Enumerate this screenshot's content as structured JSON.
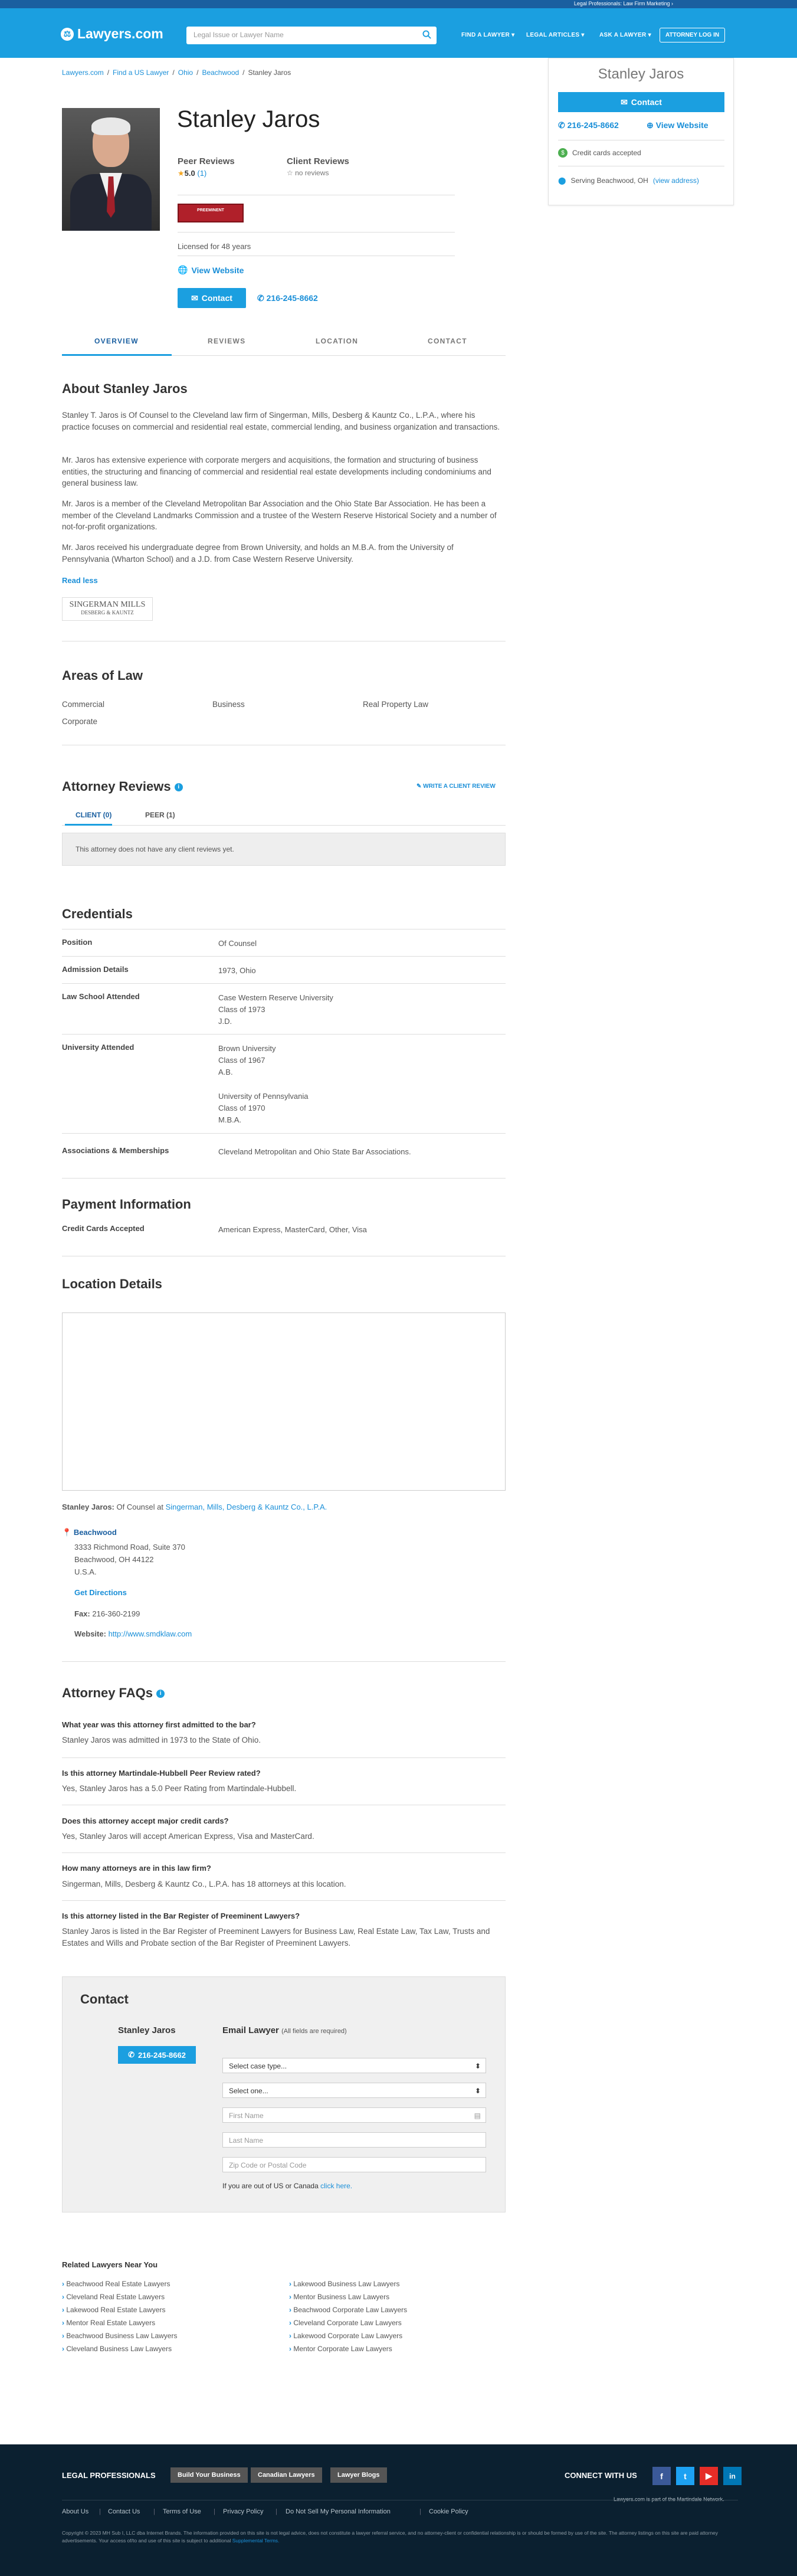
{
  "top_banner": {
    "text": "Legal Professionals: Law Firm Marketing ›"
  },
  "header": {
    "logo": "Lawyers.com",
    "search_placeholder": "Legal Issue or Lawyer Name",
    "nav": [
      "FIND A LAWYER ▾",
      "LEGAL ARTICLES ▾",
      "ASK A LAWYER ▾"
    ],
    "login": "ATTORNEY LOG IN"
  },
  "breadcrumb": [
    "Lawyers.com",
    "Find a US Lawyer",
    "Ohio",
    "Beachwood",
    "Stanley Jaros"
  ],
  "profile": {
    "name": "Stanley Jaros",
    "peer_reviews_label": "Peer Reviews",
    "peer_rating": "5.0",
    "peer_count": "(1)",
    "client_reviews_label": "Client Reviews",
    "client_reviews_value": "no reviews",
    "preeminent_badge": "PREEMINENT",
    "licensed": "Licensed for 48 years",
    "website": "View Website",
    "contact": "Contact",
    "phone": "216-245-8662"
  },
  "sidebar_card": {
    "name": "Stanley Jaros",
    "contact_button": "Contact",
    "phone": "216-245-8662",
    "website": "View Website",
    "credit_cards": "Credit cards accepted",
    "serving": "Serving Beachwood, OH",
    "view_address": "(view address)"
  },
  "tabs": [
    "OVERVIEW",
    "REVIEWS",
    "LOCATION",
    "CONTACT"
  ],
  "about": {
    "heading": "About Stanley Jaros",
    "paragraphs": [
      "Stanley T. Jaros is Of Counsel to the Cleveland law firm of Singerman, Mills, Desberg & Kauntz Co., L.P.A., where his practice focuses on commercial and residential real estate, commercial lending, and business organization and transactions.",
      "Mr. Jaros has extensive experience with corporate mergers and acquisitions, the formation and structuring of business entities, the structuring and financing of commercial and residential real estate developments including condominiums and general business law.",
      "Mr. Jaros is a member of the Cleveland Metropolitan Bar Association and the Ohio State Bar Association. He has been a member of the Cleveland Landmarks Commission and a trustee of the Western Reserve Historical Society and a number of not-for-profit organizations.",
      "Mr. Jaros received his undergraduate degree from Brown University, and holds an M.B.A. from the University of Pennsylvania (Wharton School) and a J.D. from Case Western Reserve University."
    ],
    "read_less": "Read less",
    "firm_logo": "SINGERMAN MILLS",
    "firm_logo_sub": "DESBERG & KAUNTZ"
  },
  "areas": {
    "heading": "Areas of Law",
    "items": [
      "Commercial",
      "Business",
      "Real Property Law",
      "Corporate"
    ]
  },
  "reviews": {
    "heading": "Attorney Reviews",
    "write": "WRITE A CLIENT REVIEW",
    "tabs": [
      "CLIENT (0)",
      "PEER (1)"
    ],
    "empty": "This attorney does not have any client reviews yet."
  },
  "credentials": {
    "heading": "Credentials",
    "rows": [
      {
        "label": "Position",
        "value": "Of Counsel"
      },
      {
        "label": "Admission Details",
        "value": "1973, Ohio"
      },
      {
        "label": "Law School Attended",
        "value": "Case Western Reserve University\nClass of 1973\nJ.D."
      },
      {
        "label": "University Attended",
        "value": "Brown University\nClass of 1967\nA.B.\n\nUniversity of Pennsylvania\nClass of 1970\nM.B.A."
      },
      {
        "label": "Associations & Memberships",
        "value": "Cleveland Metropolitan and Ohio State Bar Associations."
      }
    ]
  },
  "payment": {
    "heading": "Payment Information",
    "label": "Credit Cards Accepted",
    "value": "American Express, MasterCard, Other, Visa"
  },
  "location": {
    "heading": "Location Details",
    "attorney_line_name": "Stanley Jaros:",
    "attorney_line_role": "Of Counsel at",
    "firm_link": "Singerman, Mills, Desberg & Kauntz Co., L.P.A.",
    "city_heading": "Beachwood",
    "address": [
      "3333 Richmond Road, Suite 370",
      "Beachwood, OH 44122",
      "U.S.A."
    ],
    "directions": "Get Directions",
    "fax_label": "Fax:",
    "fax": "216-360-2199",
    "website_label": "Website:",
    "website": "http://www.smdklaw.com"
  },
  "faqs": {
    "heading": "Attorney FAQs",
    "items": [
      {
        "q": "What year was this attorney first admitted to the bar?",
        "a": "Stanley Jaros was admitted in 1973 to the State of Ohio."
      },
      {
        "q": "Is this attorney Martindale-Hubbell Peer Review rated?",
        "a": "Yes, Stanley Jaros has a 5.0 Peer Rating from Martindale-Hubbell."
      },
      {
        "q": "Does this attorney accept major credit cards?",
        "a": "Yes, Stanley Jaros will accept American Express, Visa and MasterCard."
      },
      {
        "q": "How many attorneys are in this law firm?",
        "a": "Singerman, Mills, Desberg & Kauntz Co., L.P.A. has 18 attorneys at this location."
      },
      {
        "q": "Is this attorney listed in the Bar Register of Preeminent Lawyers?",
        "a": "Stanley Jaros is listed in the Bar Register of Preeminent Lawyers for Business Law, Real Estate Law, Tax Law, Trusts and Estates and Wills and Probate section of the Bar Register of Preeminent Lawyers."
      }
    ]
  },
  "contact_form": {
    "heading": "Contact",
    "name": "Stanley Jaros",
    "phone": "216-245-8662",
    "email_heading": "Email Lawyer",
    "required_note": "(All fields are required)",
    "case_type": "Select case type...",
    "select_one": "Select one...",
    "first_name": "First Name",
    "last_name": "Last Name",
    "zip": "Zip Code or Postal Code",
    "outside_note": "If you are out of US or Canada",
    "click_here": "click here."
  },
  "related": {
    "heading": "Related Lawyers Near You",
    "col1": [
      "Beachwood Real Estate Lawyers",
      "Cleveland Real Estate Lawyers",
      "Lakewood Real Estate Lawyers",
      "Mentor Real Estate Lawyers",
      "Beachwood Business Law Lawyers",
      "Cleveland Business Law Lawyers"
    ],
    "col2": [
      "Lakewood Business Law Lawyers",
      "Mentor Business Law Lawyers",
      "Beachwood Corporate Law Lawyers",
      "Cleveland Corporate Law Lawyers",
      "Lakewood Corporate Law Lawyers",
      "Mentor Corporate Law Lawyers"
    ]
  },
  "footer": {
    "legal_pros": "LEGAL PROFESSIONALS",
    "buttons": [
      "Build Your Business",
      "Canadian Lawyers",
      "Lawyer Blogs"
    ],
    "connect": "CONNECT WITH US",
    "social": [
      "f",
      "t",
      "▶",
      "in"
    ],
    "part_of": "Lawyers.com is part of the Martindale Network.",
    "links": [
      "About Us",
      "Contact Us",
      "Terms of Use",
      "Privacy Policy",
      "Do Not Sell My Personal Information",
      "Cookie Policy"
    ],
    "copyright": "Copyright © 2023 MH Sub I, LLC dba Internet Brands. The information provided on this site is not legal advice, does not constitute a lawyer referral service, and no attorney-client or confidential relationship is or should be formed by use of the site. The attorney listings on this site are paid attorney advertisements. Your access of/to and use of this site is subject to additional",
    "supplemental": "Supplemental Terms."
  },
  "colors": {
    "brand": "#1b9fe0",
    "dark_brand": "#1a5fa0",
    "footer": "#0b2030",
    "badge": "#b0202a"
  }
}
